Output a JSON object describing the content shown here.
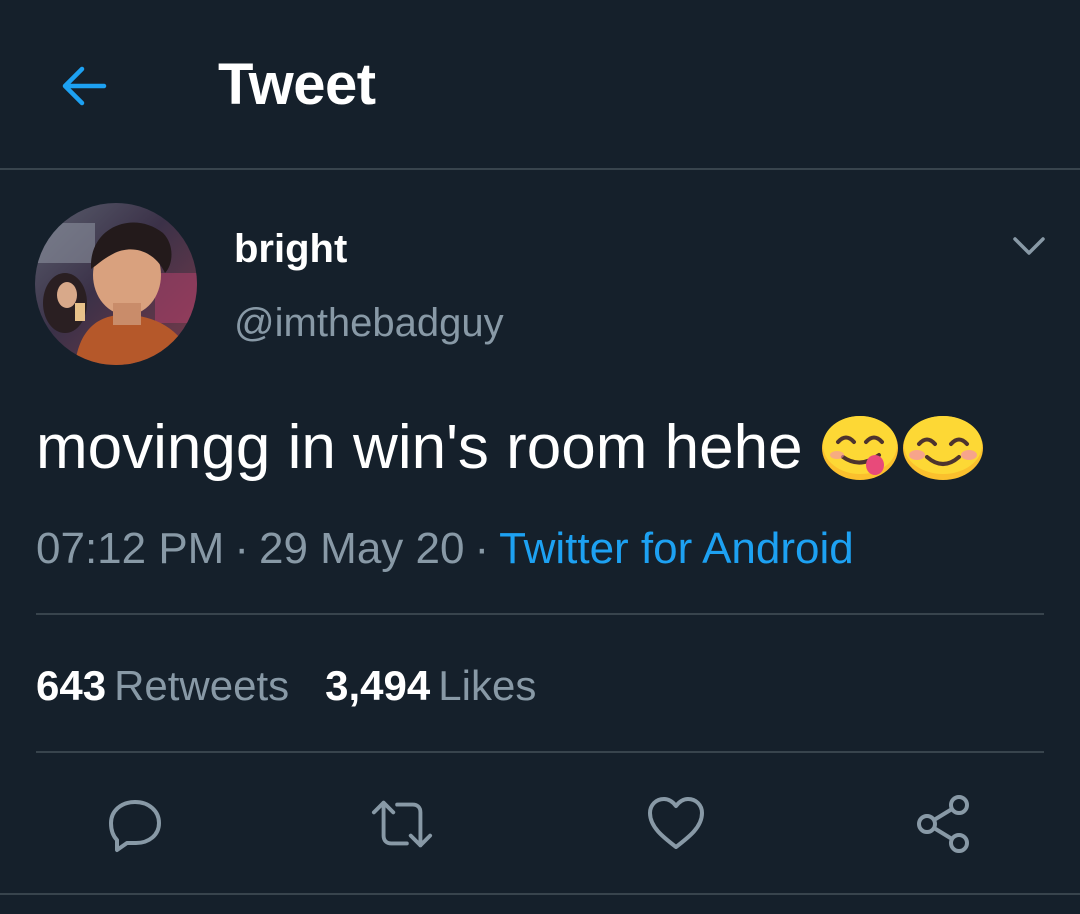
{
  "header": {
    "title": "Tweet",
    "back_icon": "arrow-left-icon"
  },
  "tweet": {
    "author": {
      "display_name": "bright",
      "handle": "@imthebadguy"
    },
    "text": "movingg in win's room hehe",
    "emojis": [
      "face-savoring-food-emoji",
      "smiling-face-with-smiling-eyes-emoji"
    ],
    "time": "07:12 PM",
    "date": "29 May 20",
    "separator": "·",
    "source": "Twitter for Android",
    "stats": {
      "retweets_count": "643",
      "retweets_label": "Retweets",
      "likes_count": "3,494",
      "likes_label": "Likes"
    }
  },
  "actions": [
    "reply-icon",
    "retweet-icon",
    "like-icon",
    "share-icon"
  ],
  "colors": {
    "background": "#15202b",
    "accent": "#1da1f2",
    "secondary_text": "#8899a6",
    "divider": "#38444d"
  }
}
